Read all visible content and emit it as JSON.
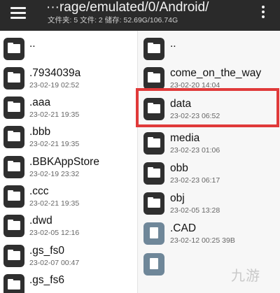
{
  "toolbar": {
    "path": "···rage/emulated/0/Android/",
    "stats": "文件夹: 5  文件: 2  储存: 52.69G/106.74G"
  },
  "left_pane": {
    "items": [
      {
        "name": "..",
        "meta": "",
        "type": "folder"
      },
      {
        "name": ".7934039a",
        "meta": "23-02-19 02:52",
        "type": "folder"
      },
      {
        "name": ".aaa",
        "meta": "23-02-21 19:35",
        "type": "folder"
      },
      {
        "name": ".bbb",
        "meta": "23-02-21 19:35",
        "type": "folder"
      },
      {
        "name": ".BBKAppStore",
        "meta": "23-02-19 23:32",
        "type": "folder"
      },
      {
        "name": ".ccc",
        "meta": "23-02-21 19:35",
        "type": "folder"
      },
      {
        "name": ".dwd",
        "meta": "23-02-05 12:16",
        "type": "folder"
      },
      {
        "name": ".gs_fs0",
        "meta": "23-02-07 00:47",
        "type": "folder"
      },
      {
        "name": ".gs_fs6",
        "meta": "",
        "type": "folder"
      }
    ]
  },
  "right_pane": {
    "items": [
      {
        "name": "..",
        "meta": "",
        "type": "folder"
      },
      {
        "name": "come_on_the_way",
        "meta": "23-02-20 14:04",
        "type": "folder"
      },
      {
        "name": "data",
        "meta": "23-02-23 06:52",
        "type": "folder"
      },
      {
        "name": "media",
        "meta": "23-02-23 01:06",
        "type": "folder"
      },
      {
        "name": "obb",
        "meta": "23-02-23 06:17",
        "type": "folder"
      },
      {
        "name": "obj",
        "meta": "23-02-05 13:28",
        "type": "folder"
      },
      {
        "name": ".CAD",
        "meta": "23-02-12 00:25  39B",
        "type": "file"
      },
      {
        "name": "",
        "meta": "",
        "type": "file"
      }
    ]
  },
  "watermark": "九游",
  "colors": {
    "toolbar_bg": "#2a2a2a",
    "highlight": "#e03a3a",
    "folder_icon": "#2f2f2f",
    "file_icon": "#6f8799"
  }
}
